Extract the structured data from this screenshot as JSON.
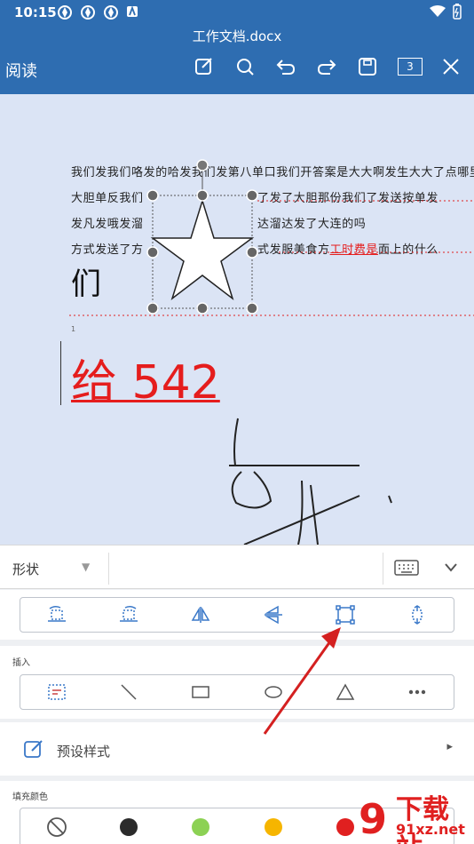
{
  "status_bar": {
    "time": "10:15"
  },
  "title_bar": {
    "document_title": "工作文档.docx",
    "mode_label": "阅读",
    "page_count": "3"
  },
  "document": {
    "lines": [
      "我们发我们咯发的哈发我们发第八单口我们开答案是大大啊发生大大了点哪里发哦",
      "大胆单反我们",
      "了发了大胆那份我们了发送按单发",
      "发凡发哦发溜",
      "达溜达发了大连的吗",
      "方式发送了方",
      "式发服美食方",
      "工时费是",
      "面上的什么"
    ],
    "large_char": "们",
    "page_number": "1",
    "red_text": "给 542"
  },
  "panel": {
    "category_label": "形状",
    "insert_label": "插入",
    "preset_label": "预设样式",
    "fill_label": "填充颜色",
    "fill_colors": [
      "#2b2b2b",
      "#8cd154",
      "#f6b500",
      "#e02020"
    ]
  },
  "watermark": {
    "main_text": "下载站",
    "sub_text": "91xz.net"
  }
}
